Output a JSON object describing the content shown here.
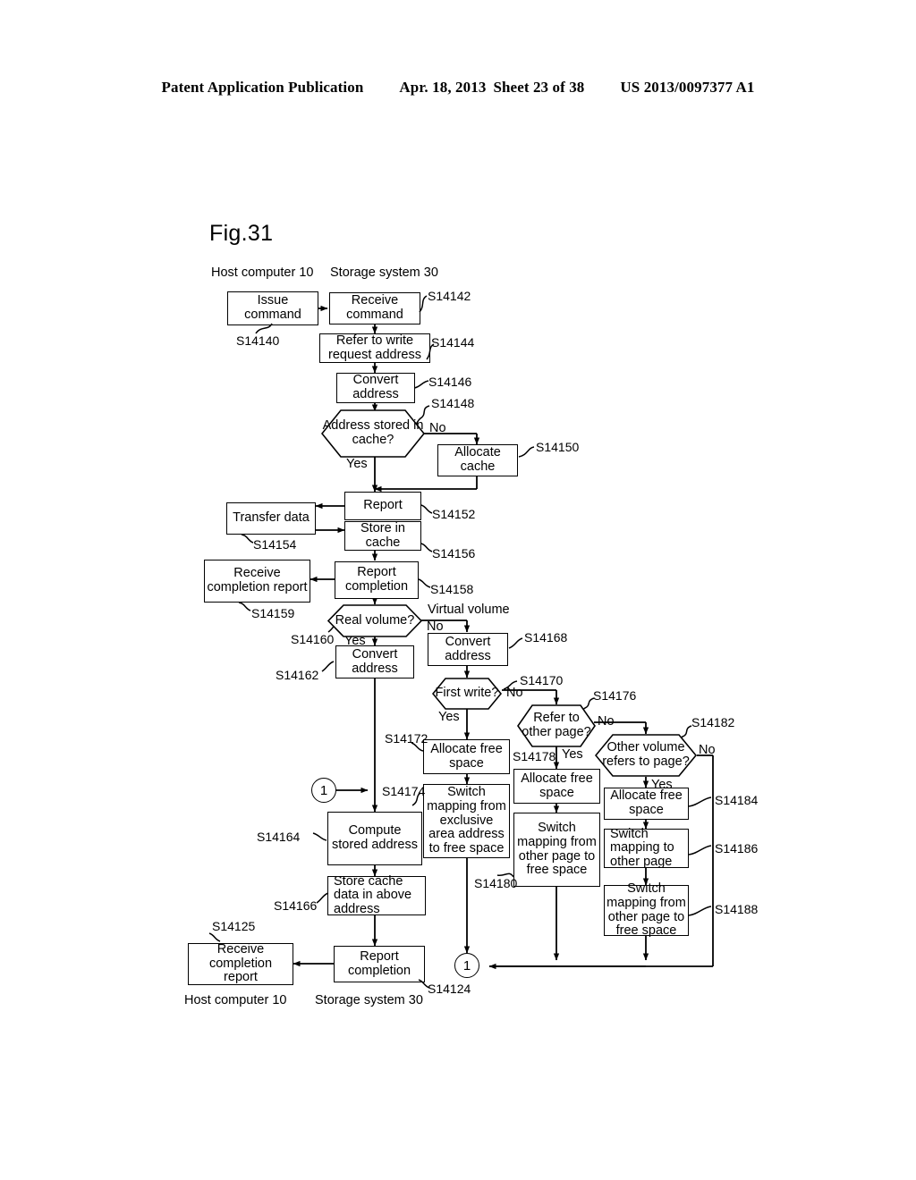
{
  "header": {
    "publication": "Patent Application Publication",
    "date": "Apr. 18, 2013",
    "sheet": "Sheet 23 of 38",
    "patent_number": "US 2013/0097377 A1"
  },
  "figure": {
    "label": "Fig.31",
    "lane_top_left": "Host computer 10",
    "lane_top_right": "Storage system 30",
    "lane_bottom_left": "Host computer 10",
    "lane_bottom_right": "Storage system 30"
  },
  "nodes": {
    "issue_command": "Issue command",
    "receive_command": "Receive command",
    "refer_write_request_address": "Refer to write request address",
    "convert_address_1": "Convert address",
    "address_stored_in_cache": "Address stored in cache?",
    "allocate_cache": "Allocate cache",
    "report": "Report",
    "transfer_data": "Transfer data",
    "store_in_cache": "Store in cache",
    "receive_completion_report_1": "Receive completion report",
    "report_completion_1": "Report completion",
    "real_volume": "Real volume?",
    "convert_address_2": "Convert address",
    "convert_address_3": "Convert address",
    "first_write": "First write?",
    "refer_to_other_page": "Refer to other page?",
    "other_volume_refers_to_page": "Other volume refers to page?",
    "allocate_free_space_1": "Allocate free space",
    "allocate_free_space_2": "Allocate free space",
    "allocate_free_space_3": "Allocate free space",
    "switch_mapping_exclusive": "Switch mapping from exclusive area address to free space",
    "switch_mapping_other_page_to_free": "Switch mapping from other page to free space",
    "switch_mapping_to_other_page": "Switch mapping to other page",
    "switch_mapping_from_other_page_to_free": "Switch mapping from other page to free space",
    "compute_stored_address": "Compute stored address",
    "store_cache_data": "Store cache data in above address",
    "report_completion_2": "Report completion",
    "receive_completion_report_2": "Receive completion report",
    "connector_a": "1",
    "connector_b": "1"
  },
  "step_refs": {
    "s14140": "S14140",
    "s14142": "S14142",
    "s14144": "S14144",
    "s14146": "S14146",
    "s14148": "S14148",
    "s14150": "S14150",
    "s14152": "S14152",
    "s14154": "S14154",
    "s14156": "S14156",
    "s14158": "S14158",
    "s14159": "S14159",
    "s14160": "S14160",
    "s14162": "S14162",
    "s14164": "S14164",
    "s14166": "S14166",
    "s14168": "S14168",
    "s14170": "S14170",
    "s14172": "S14172",
    "s14174": "S14174",
    "s14176": "S14176",
    "s14178": "S14178",
    "s14180": "S14180",
    "s14182": "S14182",
    "s14184": "S14184",
    "s14186": "S14186",
    "s14188": "S14188",
    "s14124": "S14124",
    "s14125": "S14125"
  },
  "branch_labels": {
    "cache_no": "No",
    "cache_yes": "Yes",
    "real_volume_yes": "Yes",
    "real_volume_no": "No",
    "virtual_volume": "Virtual volume",
    "first_write_yes": "Yes",
    "first_write_no": "No",
    "refer_other_page_yes": "Yes",
    "refer_other_page_no": "No",
    "other_volume_yes": "Yes",
    "other_volume_no": "No"
  },
  "colors": {
    "ink": "#000000",
    "paper": "#ffffff"
  }
}
